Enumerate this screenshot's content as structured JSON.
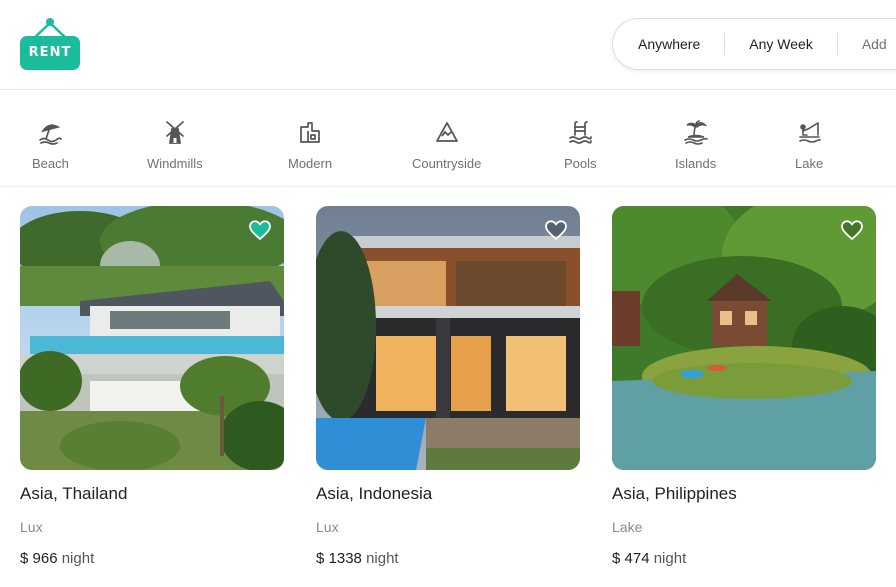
{
  "brand": {
    "logo_text": "RENT",
    "accent": "#1abc9c"
  },
  "search": {
    "where": "Anywhere",
    "when": "Any Week",
    "guests": "Add"
  },
  "categories": [
    {
      "label": "Beach",
      "icon": "beach-umbrella-icon"
    },
    {
      "label": "Windmills",
      "icon": "windmill-icon"
    },
    {
      "label": "Modern",
      "icon": "modern-building-icon"
    },
    {
      "label": "Countryside",
      "icon": "mountain-icon"
    },
    {
      "label": "Pools",
      "icon": "pool-ladder-icon"
    },
    {
      "label": "Islands",
      "icon": "palm-island-icon"
    },
    {
      "label": "Lake",
      "icon": "lake-fishing-icon"
    }
  ],
  "listings": [
    {
      "location": "Asia, Thailand",
      "category": "Lux",
      "price": "$ 966",
      "unit": "night",
      "favorited": true
    },
    {
      "location": "Asia, Indonesia",
      "category": "Lux",
      "price": "$ 1338",
      "unit": "night",
      "favorited": false
    },
    {
      "location": "Asia, Philippines",
      "category": "Lake",
      "price": "$ 474",
      "unit": "night",
      "favorited": false
    }
  ]
}
